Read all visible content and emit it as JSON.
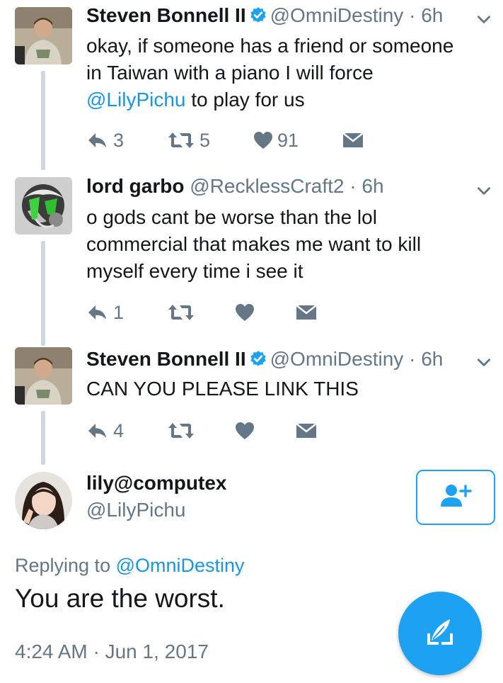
{
  "colors": {
    "accent": "#1da1f2",
    "mention": "#1b95e0",
    "secondary_text": "#657786",
    "thread_line": "#cfd8de"
  },
  "tweets": [
    {
      "name": "Steven Bonnell II",
      "verified": true,
      "handle": "@OmniDestiny",
      "dot": "·",
      "time": "6h",
      "lines": [
        "okay, if someone has a friend or someone",
        "in Taiwan with a piano I will force"
      ],
      "mention": "@LilyPichu",
      "after_mention": " to play for us",
      "reply_count": "3",
      "retweet_count": "5",
      "like_count": "91"
    },
    {
      "name": "lord garbo",
      "handle": "@RecklessCraft2",
      "dot": "·",
      "time": "6h",
      "lines": [
        "o gods cant be worse than the lol",
        "commercial that makes me want to kill",
        "myself every time i see it"
      ],
      "reply_count": "1"
    },
    {
      "name": "Steven Bonnell II",
      "verified": true,
      "handle": "@OmniDestiny",
      "dot": "·",
      "time": "6h",
      "lines": [
        "CAN YOU PLEASE LINK THIS"
      ],
      "reply_count": "4"
    }
  ],
  "focus": {
    "name": "lily@computex",
    "handle": "@LilyPichu",
    "replying_prefix": "Replying to ",
    "replying_handle": "@OmniDestiny",
    "text": "You are the worst.",
    "timestamp": "4:24 AM · Jun 1, 2017"
  },
  "icons": {
    "verified": "verified-badge-icon",
    "chevron": "chevron-down-icon",
    "reply": "reply-icon",
    "retweet": "retweet-icon",
    "like": "heart-icon",
    "dm": "envelope-icon",
    "follow": "add-user-icon",
    "compose": "quill-compose-icon"
  }
}
